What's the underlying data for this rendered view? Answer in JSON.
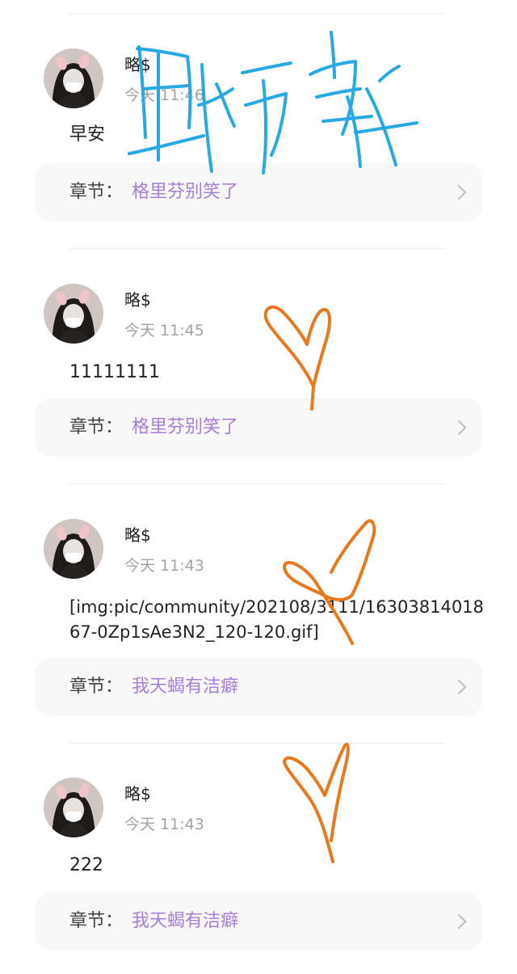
{
  "colors": {
    "chapter_title": "#a77fd8",
    "chapter_label": "#444444",
    "time": "#a3a3a3",
    "card_background": "#f8f8f8",
    "doodle_blue": "#29a9e1",
    "doodle_orange": "#e8791e"
  },
  "posts": [
    {
      "username": "略$",
      "time": "今天 11:46",
      "content": "早安",
      "chapter_label": "章节：",
      "chapter_title": "格里芬别笑了"
    },
    {
      "username": "略$",
      "time": "今天 11:45",
      "content": "11111111",
      "chapter_label": "章节：",
      "chapter_title": "格里芬别笑了"
    },
    {
      "username": "略$",
      "time": "今天 11:43",
      "content": "[img:pic/community/202108/3111/1630381401867-0Zp1sAe3N2_120-120.gif]",
      "chapter_label": "章节：",
      "chapter_title": "我天蝎有洁癖"
    },
    {
      "username": "略$",
      "time": "今天 11:43",
      "content": "222",
      "chapter_label": "章节：",
      "chapter_title": "我天蝎有洁癖"
    }
  ],
  "icons": {
    "avatar": "avatar-photo",
    "chevron": "chevron-right-icon"
  }
}
